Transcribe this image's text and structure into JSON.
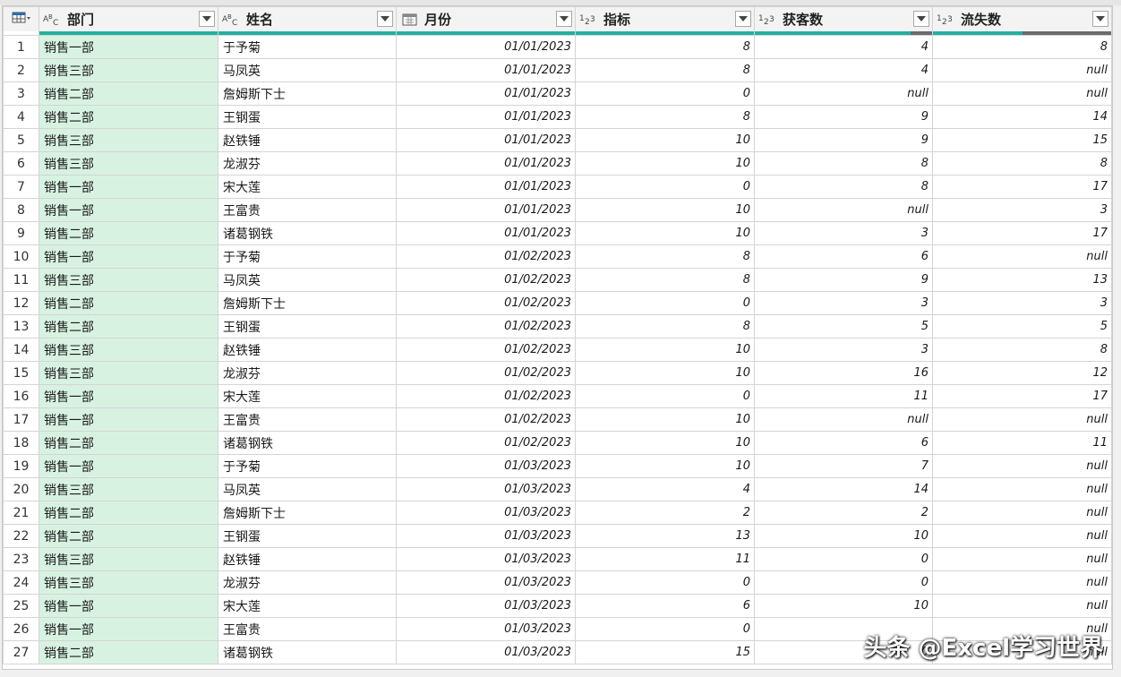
{
  "columns": [
    {
      "key": "dept",
      "label": "部门",
      "type_icon": "ABC"
    },
    {
      "key": "name",
      "label": "姓名",
      "type_icon": "ABC"
    },
    {
      "key": "month",
      "label": "月份",
      "type_icon": "calendar-icon"
    },
    {
      "key": "target",
      "label": "指标",
      "type_icon": "123"
    },
    {
      "key": "gained",
      "label": "获客数",
      "type_icon": "123"
    },
    {
      "key": "lost",
      "label": "流失数",
      "type_icon": "123"
    }
  ],
  "quality": {
    "valid_color": "#20b2a0",
    "error_color": "#6b6b6b",
    "gained_valid_fraction": 0.88,
    "lost_valid_fraction": 0.5
  },
  "rows": [
    [
      "1",
      "销售一部",
      "于予菊",
      "01/01/2023",
      "8",
      "4",
      "8"
    ],
    [
      "2",
      "销售三部",
      "马凤英",
      "01/01/2023",
      "8",
      "4",
      "null"
    ],
    [
      "3",
      "销售二部",
      "詹姆斯下士",
      "01/01/2023",
      "0",
      "null",
      "null"
    ],
    [
      "4",
      "销售二部",
      "王钢蛋",
      "01/01/2023",
      "8",
      "9",
      "14"
    ],
    [
      "5",
      "销售三部",
      "赵铁锤",
      "01/01/2023",
      "10",
      "9",
      "15"
    ],
    [
      "6",
      "销售三部",
      "龙淑芬",
      "01/01/2023",
      "10",
      "8",
      "8"
    ],
    [
      "7",
      "销售一部",
      "宋大莲",
      "01/01/2023",
      "0",
      "8",
      "17"
    ],
    [
      "8",
      "销售一部",
      "王富贵",
      "01/01/2023",
      "10",
      "null",
      "3"
    ],
    [
      "9",
      "销售二部",
      "诸葛钢铁",
      "01/01/2023",
      "10",
      "3",
      "17"
    ],
    [
      "10",
      "销售一部",
      "于予菊",
      "01/02/2023",
      "8",
      "6",
      "null"
    ],
    [
      "11",
      "销售三部",
      "马凤英",
      "01/02/2023",
      "8",
      "9",
      "13"
    ],
    [
      "12",
      "销售二部",
      "詹姆斯下士",
      "01/02/2023",
      "0",
      "3",
      "3"
    ],
    [
      "13",
      "销售二部",
      "王钢蛋",
      "01/02/2023",
      "8",
      "5",
      "5"
    ],
    [
      "14",
      "销售三部",
      "赵铁锤",
      "01/02/2023",
      "10",
      "3",
      "8"
    ],
    [
      "15",
      "销售三部",
      "龙淑芬",
      "01/02/2023",
      "10",
      "16",
      "12"
    ],
    [
      "16",
      "销售一部",
      "宋大莲",
      "01/02/2023",
      "0",
      "11",
      "17"
    ],
    [
      "17",
      "销售一部",
      "王富贵",
      "01/02/2023",
      "10",
      "null",
      "null"
    ],
    [
      "18",
      "销售二部",
      "诸葛钢铁",
      "01/02/2023",
      "10",
      "6",
      "11"
    ],
    [
      "19",
      "销售一部",
      "于予菊",
      "01/03/2023",
      "10",
      "7",
      "null"
    ],
    [
      "20",
      "销售三部",
      "马凤英",
      "01/03/2023",
      "4",
      "14",
      "null"
    ],
    [
      "21",
      "销售二部",
      "詹姆斯下士",
      "01/03/2023",
      "2",
      "2",
      "null"
    ],
    [
      "22",
      "销售二部",
      "王钢蛋",
      "01/03/2023",
      "13",
      "10",
      "null"
    ],
    [
      "23",
      "销售三部",
      "赵铁锤",
      "01/03/2023",
      "11",
      "0",
      "null"
    ],
    [
      "24",
      "销售三部",
      "龙淑芬",
      "01/03/2023",
      "0",
      "0",
      "null"
    ],
    [
      "25",
      "销售一部",
      "宋大莲",
      "01/03/2023",
      "6",
      "10",
      "null"
    ],
    [
      "26",
      "销售一部",
      "王富贵",
      "01/03/2023",
      "0",
      "",
      "null"
    ],
    [
      "27",
      "销售二部",
      "诸葛钢铁",
      "01/03/2023",
      "15",
      "0",
      "null"
    ]
  ],
  "watermark": "头条 @Excel学习世界"
}
